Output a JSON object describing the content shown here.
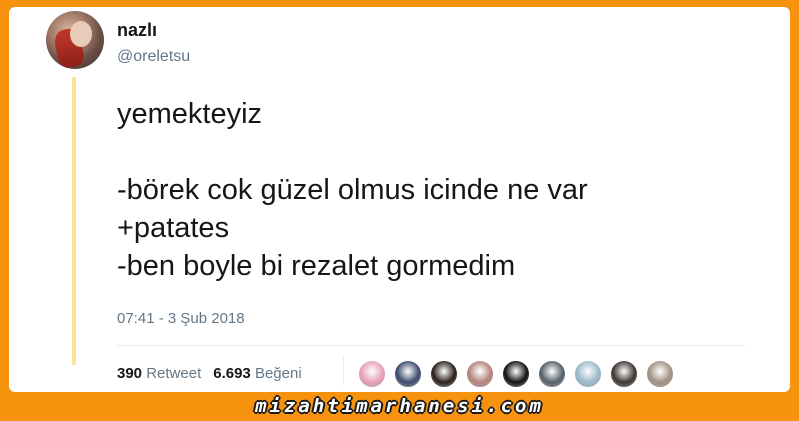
{
  "tweet": {
    "display_name": "nazlı",
    "handle": "@oreletsu",
    "text": "yemekteyiz\n\n-börek cok güzel olmus icinde ne var\n+patates\n-ben boyle bi rezalet gormedim",
    "timestamp": "07:41 - 3 Şub 2018"
  },
  "stats": {
    "retweet_count": "390",
    "retweet_label": "Retweet",
    "like_count": "6.693",
    "like_label": "Beğeni"
  },
  "likers": [
    {
      "avatar": "liker-avatar-1",
      "color": "#e8a0b8"
    },
    {
      "avatar": "liker-avatar-2",
      "color": "#3a4a6a"
    },
    {
      "avatar": "liker-avatar-3",
      "color": "#2a1f1a"
    },
    {
      "avatar": "liker-avatar-4",
      "color": "#b4827a"
    },
    {
      "avatar": "liker-avatar-5",
      "color": "#111111"
    },
    {
      "avatar": "liker-avatar-6",
      "color": "#55606a"
    },
    {
      "avatar": "liker-avatar-7",
      "color": "#9ab8c8"
    },
    {
      "avatar": "liker-avatar-8",
      "color": "#3d3532"
    },
    {
      "avatar": "liker-avatar-9",
      "color": "#a09080"
    }
  ],
  "watermark": "mizahtimarhanesi.com",
  "colors": {
    "frame": "#f7920f",
    "thread_line": "#fbe39a",
    "text_primary": "#14171a",
    "text_secondary": "#657786"
  }
}
